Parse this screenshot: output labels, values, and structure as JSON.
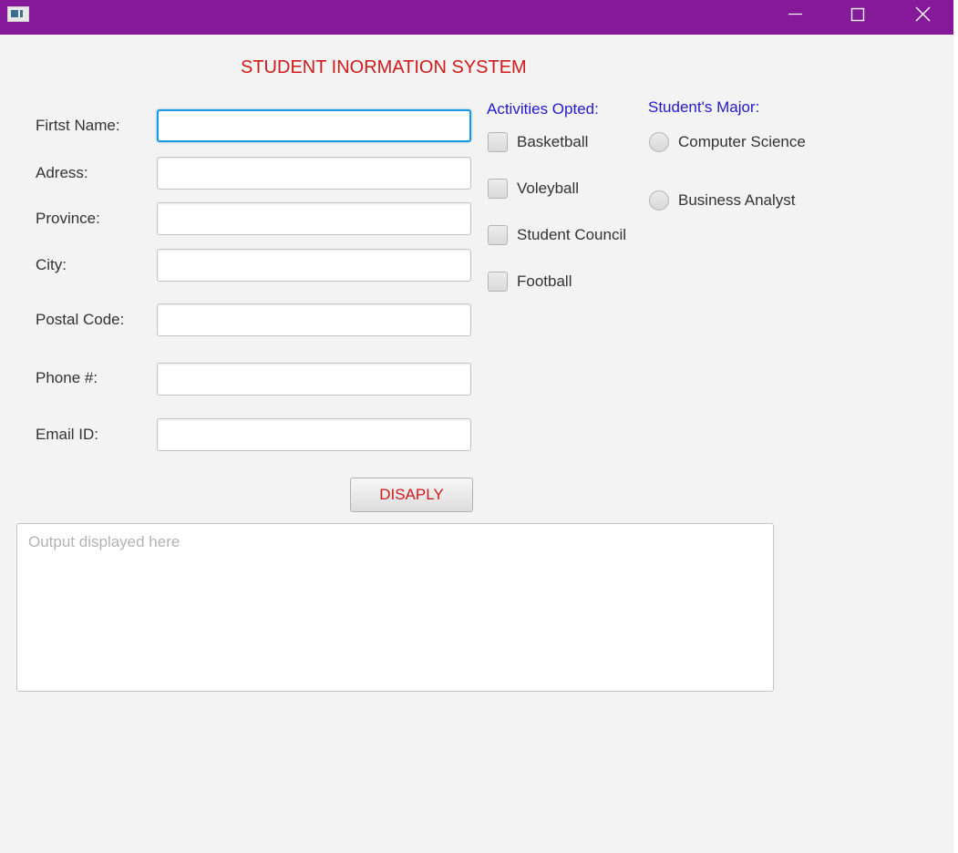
{
  "window": {
    "titlebar_color": "#86199a",
    "icons": [
      "app-icon",
      "minimize-icon",
      "maximize-icon",
      "close-icon"
    ]
  },
  "header": {
    "title": "STUDENT INORMATION SYSTEM",
    "title_color": "#d11a1a"
  },
  "form": {
    "first_name_label": "Firtst Name:",
    "first_name_value": "",
    "address_label": "Adress:",
    "address_value": "",
    "province_label": "Province:",
    "province_value": "",
    "city_label": "City:",
    "city_value": "",
    "postal_label": "Postal Code:",
    "postal_value": "",
    "phone_label": "Phone #:",
    "phone_value": "",
    "email_label": "Email ID:",
    "email_value": ""
  },
  "activities": {
    "heading": "Activities Opted:",
    "heading_color": "#2419c9",
    "items": [
      {
        "label": "Basketball",
        "checked": false
      },
      {
        "label": "Voleyball",
        "checked": false
      },
      {
        "label": "Student Council",
        "checked": false
      },
      {
        "label": "Football",
        "checked": false
      }
    ]
  },
  "major": {
    "heading": "Student's Major:",
    "options": [
      {
        "label": "Computer Science",
        "selected": false
      },
      {
        "label": "Business Analyst",
        "selected": false
      }
    ]
  },
  "actions": {
    "display_label": "DISAPLY"
  },
  "output": {
    "placeholder": "Output displayed here",
    "value": ""
  }
}
